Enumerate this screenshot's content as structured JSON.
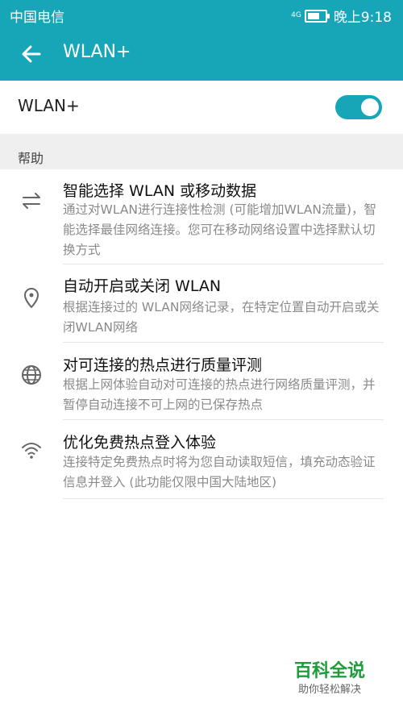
{
  "status_bar": {
    "carrier": "中国电信",
    "signal_text": "4G",
    "battery_level": 0.7,
    "time": "晚上9:18"
  },
  "app_bar": {
    "back_icon": "arrow-left",
    "title": "WLAN+"
  },
  "toggle": {
    "label": "WLAN+",
    "state": "on",
    "accent": "#17a6b8"
  },
  "help": {
    "title": "帮助",
    "items": [
      {
        "icon": "swap-arrows-icon",
        "title": "智能选择 WLAN 或移动数据",
        "desc": "通过对WLAN进行连接性检测 (可能增加WLAN流量)，智能选择最佳网络连接。您可在移动网络设置中选择默认切换方式"
      },
      {
        "icon": "location-pin-icon",
        "title": "自动开启或关闭 WLAN",
        "desc": "根据连接过的 WLAN网络记录，在特定位置自动开启或关闭WLAN网络"
      },
      {
        "icon": "globe-icon",
        "title": "对可连接的热点进行质量评测",
        "desc": "根据上网体验自动对可连接的热点进行网络质量评测，并暂停自动连接不可上网的已保存热点"
      },
      {
        "icon": "wifi-icon",
        "title": "优化免费热点登入体验",
        "desc": "连接特定免费热点时将为您自动读取短信，填充动态验证信息并登入 (此功能仅限中国大陆地区)"
      }
    ]
  },
  "watermark": {
    "title": "百科全说",
    "subtitle": "助你轻松解决"
  }
}
